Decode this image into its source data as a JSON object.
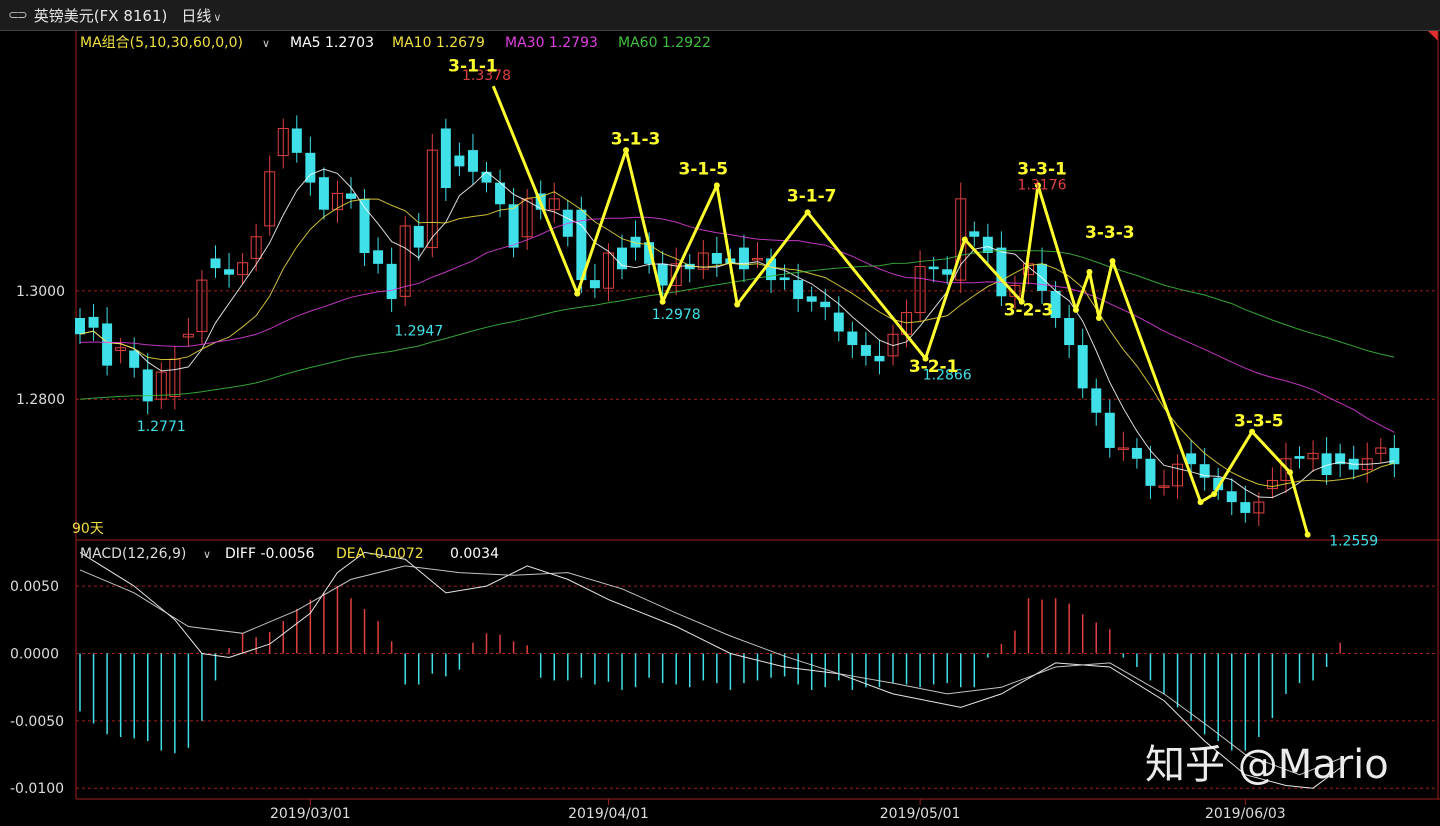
{
  "header": {
    "link_icon": "link-icon",
    "symbol_title": "英镑美元(FX 8161)",
    "period_label": "日线",
    "period_chevron": "chevron-down-icon"
  },
  "main_legend": {
    "group_label": "MA组合(5,10,30,60,0,0)",
    "ma5": "MA5 1.2703",
    "ma10": "MA10 1.2679",
    "ma30": "MA30 1.2793",
    "ma60": "MA60 1.2922",
    "colors": {
      "ma5": "#ffffff",
      "ma10": "#f0e040",
      "ma30": "#e040e0",
      "ma60": "#40c040"
    }
  },
  "range_label": "90天",
  "macd_legend": {
    "label": "MACD(12,26,9)",
    "diff": "DIFF -0.0056",
    "dea": "DEA -0.0072",
    "macd": "0.0034"
  },
  "watermark": "知乎 @Mario",
  "colors": {
    "up": "#e04040",
    "down": "#40e0e8",
    "wave": "#ffff30",
    "grid": "#a02020"
  },
  "chart_data": [
    {
      "type": "candlestick",
      "title": "英镑美元(FX 8161) 日线",
      "ylim": [
        1.254,
        1.348
      ],
      "yticks": [
        "1.2800",
        "1.3000"
      ],
      "ytick_values": [
        1.28,
        1.3
      ],
      "xticks": [
        "2019/03/01",
        "2019/04/01",
        "2019/05/01",
        "2019/06/03"
      ],
      "xtick_index": [
        17,
        39,
        62,
        86
      ],
      "num_bars": 94,
      "candles": [
        [
          1.295,
          1.292
        ],
        [
          1.2952,
          1.2932
        ],
        [
          1.294,
          1.2862
        ],
        [
          1.289,
          1.2895
        ],
        [
          1.289,
          1.2858
        ],
        [
          1.2855,
          1.2796
        ],
        [
          1.28,
          1.285
        ],
        [
          1.2805,
          1.2874
        ],
        [
          1.2915,
          1.292
        ],
        [
          1.2925,
          1.302
        ],
        [
          1.306,
          1.3042
        ],
        [
          1.304,
          1.303
        ],
        [
          1.303,
          1.3052
        ],
        [
          1.306,
          1.31
        ],
        [
          1.312,
          1.322
        ],
        [
          1.325,
          1.33
        ],
        [
          1.33,
          1.3255
        ],
        [
          1.3255,
          1.32
        ],
        [
          1.321,
          1.315
        ],
        [
          1.315,
          1.318
        ],
        [
          1.318,
          1.317
        ],
        [
          1.317,
          1.307
        ],
        [
          1.3075,
          1.305
        ],
        [
          1.305,
          1.2985
        ],
        [
          1.299,
          1.312
        ],
        [
          1.312,
          1.308
        ],
        [
          1.308,
          1.326
        ],
        [
          1.33,
          1.319
        ],
        [
          1.325,
          1.323
        ],
        [
          1.326,
          1.322
        ],
        [
          1.322,
          1.32
        ],
        [
          1.32,
          1.316
        ],
        [
          1.316,
          1.308
        ],
        [
          1.31,
          1.317
        ],
        [
          1.318,
          1.315
        ],
        [
          1.315,
          1.317
        ],
        [
          1.315,
          1.31
        ],
        [
          1.315,
          1.302
        ],
        [
          1.302,
          1.3005
        ],
        [
          1.3005,
          1.307
        ],
        [
          1.308,
          1.304
        ],
        [
          1.31,
          1.308
        ],
        [
          1.309,
          1.305
        ],
        [
          1.305,
          1.301
        ],
        [
          1.301,
          1.305
        ],
        [
          1.305,
          1.304
        ],
        [
          1.304,
          1.307
        ],
        [
          1.307,
          1.305
        ],
        [
          1.306,
          1.305
        ],
        [
          1.308,
          1.304
        ],
        [
          1.306,
          1.306
        ],
        [
          1.306,
          1.302
        ],
        [
          1.3025,
          1.302
        ],
        [
          1.302,
          1.2985
        ],
        [
          1.299,
          1.298
        ],
        [
          1.298,
          1.297
        ],
        [
          1.296,
          1.2925
        ],
        [
          1.2925,
          1.29
        ],
        [
          1.29,
          1.288
        ],
        [
          1.288,
          1.287
        ],
        [
          1.288,
          1.292
        ],
        [
          1.292,
          1.296
        ],
        [
          1.296,
          1.3045
        ],
        [
          1.3045,
          1.304
        ],
        [
          1.304,
          1.303
        ],
        [
          1.302,
          1.317
        ],
        [
          1.311,
          1.31
        ],
        [
          1.31,
          1.307
        ],
        [
          1.308,
          1.299
        ],
        [
          1.299,
          1.301
        ],
        [
          1.303,
          1.305
        ],
        [
          1.305,
          1.3
        ],
        [
          1.3,
          1.295
        ],
        [
          1.295,
          1.29
        ],
        [
          1.29,
          1.282
        ],
        [
          1.282,
          1.2775
        ],
        [
          1.2775,
          1.271
        ],
        [
          1.271,
          1.271
        ],
        [
          1.271,
          1.269
        ],
        [
          1.269,
          1.264
        ],
        [
          1.264,
          1.264
        ],
        [
          1.264,
          1.268
        ],
        [
          1.27,
          1.268
        ],
        [
          1.268,
          1.2655
        ],
        [
          1.2655,
          1.2632
        ],
        [
          1.263,
          1.261
        ],
        [
          1.261,
          1.259
        ],
        [
          1.259,
          1.261
        ],
        [
          1.2635,
          1.265
        ],
        [
          1.265,
          1.269
        ],
        [
          1.2695,
          1.269
        ],
        [
          1.269,
          1.27
        ],
        [
          1.27,
          1.266
        ],
        [
          1.27,
          1.268
        ],
        [
          1.269,
          1.267
        ],
        [
          1.267,
          1.269
        ],
        [
          1.27,
          1.271
        ],
        [
          1.271,
          1.268
        ]
      ],
      "annotations": [
        {
          "text": "1.3378",
          "color": "#e04040",
          "index": 30,
          "value": 1.3378
        },
        {
          "text": "1.2947",
          "color": "#40e0e8",
          "index": 25,
          "value": 1.2947
        },
        {
          "text": "1.2771",
          "color": "#40e0e8",
          "index": 6,
          "value": 1.2771
        },
        {
          "text": "1.2978",
          "color": "#40e0e8",
          "index": 44,
          "value": 1.2978
        },
        {
          "text": "1.2866",
          "color": "#40e0e8",
          "index": 64,
          "value": 1.2866
        },
        {
          "text": "1.3176",
          "color": "#e04040",
          "index": 71,
          "value": 1.3176
        },
        {
          "text": "1.2559",
          "color": "#40e0e8",
          "index": 94,
          "value": 1.2559
        }
      ],
      "wave_labels": [
        {
          "text": "3-1-1",
          "index": 29,
          "value": 1.3405
        },
        {
          "text": "3-1-3",
          "index": 41,
          "value": 1.327
        },
        {
          "text": "3-1-5",
          "index": 46,
          "value": 1.3215
        },
        {
          "text": "3-1-7",
          "index": 54,
          "value": 1.3165
        },
        {
          "text": "3-2-1",
          "index": 63,
          "value": 1.285
        },
        {
          "text": "3-3-1",
          "index": 71,
          "value": 1.3215
        },
        {
          "text": "3-2-3",
          "index": 70,
          "value": 1.2955
        },
        {
          "text": "3-3-3",
          "index": 76,
          "value": 1.3098
        },
        {
          "text": "3-3-5",
          "index": 87,
          "value": 1.275
        }
      ],
      "wave_path": [
        [
          30.5,
          1.3378
        ],
        [
          36.7,
          1.2995
        ],
        [
          40.3,
          1.326
        ],
        [
          43.0,
          1.298
        ],
        [
          47.0,
          1.3195
        ],
        [
          48.5,
          1.2975
        ],
        [
          53.7,
          1.3145
        ],
        [
          62.4,
          1.2875
        ],
        [
          65.3,
          1.3095
        ],
        [
          69.5,
          1.298
        ],
        [
          70.7,
          1.3195
        ],
        [
          73.5,
          1.2965
        ],
        [
          74.5,
          1.3035
        ],
        [
          75.2,
          1.295
        ],
        [
          76.2,
          1.3055
        ],
        [
          82.7,
          1.261
        ],
        [
          83.7,
          1.2625
        ],
        [
          86.5,
          1.274
        ],
        [
          89.3,
          1.2665
        ],
        [
          90.6,
          1.255
        ]
      ]
    },
    {
      "type": "macd",
      "ylim": [
        -0.0108,
        0.0082
      ],
      "yticks": [
        "0.0050",
        "0.0000",
        "-0.0050",
        "-0.0100"
      ],
      "ytick_values": [
        0.005,
        0.0,
        -0.005,
        -0.01
      ],
      "histogram": [
        -0.0043,
        -0.0052,
        -0.006,
        -0.0062,
        -0.0063,
        -0.0065,
        -0.0072,
        -0.0074,
        -0.007,
        -0.005,
        -0.002,
        0.0004,
        0.0015,
        0.0012,
        0.0016,
        0.0024,
        0.0033,
        0.004,
        0.0045,
        0.005,
        0.0041,
        0.0033,
        0.0024,
        0.0009,
        -0.0023,
        -0.0023,
        -0.0015,
        -0.0017,
        -0.0012,
        0.0008,
        0.0015,
        0.0014,
        0.0009,
        0.0006,
        -0.0018,
        -0.002,
        -0.002,
        -0.0018,
        -0.0023,
        -0.0021,
        -0.0027,
        -0.0025,
        -0.0018,
        -0.0022,
        -0.0023,
        -0.0025,
        -0.002,
        -0.0022,
        -0.0027,
        -0.0022,
        -0.002,
        -0.0018,
        -0.0017,
        -0.0023,
        -0.0027,
        -0.0025,
        -0.002,
        -0.0027,
        -0.0025,
        -0.0025,
        -0.0022,
        -0.0023,
        -0.0025,
        -0.0023,
        -0.0022,
        -0.0025,
        -0.0025,
        -0.0003,
        0.0007,
        0.0017,
        0.0041,
        0.004,
        0.0041,
        0.0037,
        0.0029,
        0.0023,
        0.0018,
        -0.0003,
        -0.001,
        -0.002,
        -0.003,
        -0.004,
        -0.005,
        -0.006,
        -0.0065,
        -0.0072,
        -0.0072,
        -0.0062,
        -0.0048,
        -0.003,
        -0.0022,
        -0.002,
        -0.001,
        0.0008
      ],
      "diff_line": [
        [
          0,
          0.0075
        ],
        [
          4,
          0.005
        ],
        [
          7,
          0.0025
        ],
        [
          9,
          0.0
        ],
        [
          11,
          -0.0003
        ],
        [
          14,
          0.0007
        ],
        [
          17,
          0.003
        ],
        [
          19,
          0.006
        ],
        [
          21,
          0.0075
        ],
        [
          24,
          0.007
        ],
        [
          27,
          0.0045
        ],
        [
          30,
          0.005
        ],
        [
          33,
          0.0065
        ],
        [
          36,
          0.0055
        ],
        [
          39,
          0.004
        ],
        [
          44,
          0.002
        ],
        [
          48,
          0.0
        ],
        [
          52,
          -0.001
        ],
        [
          56,
          -0.0015
        ],
        [
          60,
          -0.003
        ],
        [
          65,
          -0.004
        ],
        [
          68,
          -0.003
        ],
        [
          72,
          -0.0007
        ],
        [
          76,
          -0.001
        ],
        [
          80,
          -0.0035
        ],
        [
          83,
          -0.0065
        ],
        [
          86,
          -0.009
        ],
        [
          89,
          -0.0098
        ],
        [
          91,
          -0.01
        ],
        [
          93,
          -0.0085
        ]
      ],
      "dea_line": [
        [
          0,
          0.0062
        ],
        [
          4,
          0.0045
        ],
        [
          8,
          0.002
        ],
        [
          12,
          0.0015
        ],
        [
          16,
          0.0032
        ],
        [
          20,
          0.0055
        ],
        [
          24,
          0.0065
        ],
        [
          28,
          0.006
        ],
        [
          32,
          0.0058
        ],
        [
          36,
          0.006
        ],
        [
          40,
          0.0048
        ],
        [
          44,
          0.003
        ],
        [
          48,
          0.0013
        ],
        [
          52,
          -0.0002
        ],
        [
          56,
          -0.0015
        ],
        [
          60,
          -0.0022
        ],
        [
          64,
          -0.003
        ],
        [
          68,
          -0.0025
        ],
        [
          72,
          -0.001
        ],
        [
          76,
          -0.0007
        ],
        [
          80,
          -0.003
        ],
        [
          83,
          -0.0052
        ],
        [
          86,
          -0.0075
        ],
        [
          90,
          -0.009
        ],
        [
          93,
          -0.0078
        ]
      ]
    }
  ]
}
